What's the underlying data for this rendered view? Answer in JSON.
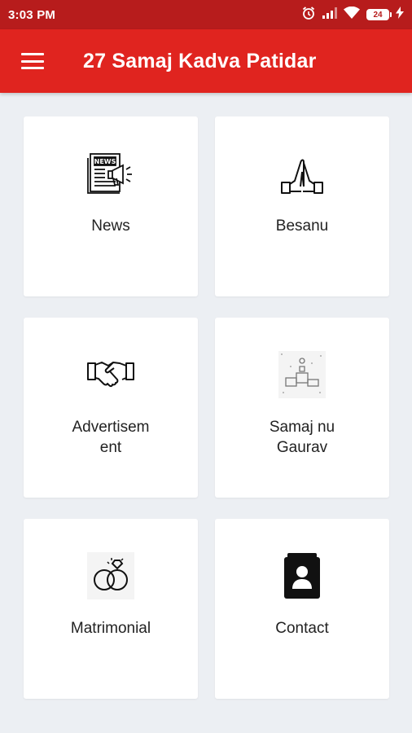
{
  "status_bar": {
    "time": "3:03 PM",
    "battery": "24",
    "icons": [
      "alarm-icon",
      "signal-icon",
      "wifi-icon",
      "battery-icon",
      "charging-icon"
    ]
  },
  "app_bar": {
    "title": "27 Samaj Kadva Patidar",
    "menu_icon": "hamburger-menu-icon",
    "color": "#e0241f"
  },
  "status_bar_color": "#b71c1c",
  "menu_items": [
    {
      "label": "News",
      "icon": "newspaper-icon"
    },
    {
      "label": "Besanu",
      "icon": "praying-hands-icon"
    },
    {
      "label": "Advertisem\nent",
      "icon": "handshake-icon"
    },
    {
      "label": "Samaj nu\nGaurav",
      "icon": "podium-icon"
    },
    {
      "label": "Matrimonial",
      "icon": "wedding-rings-icon"
    },
    {
      "label": "Contact",
      "icon": "contact-book-icon"
    }
  ]
}
